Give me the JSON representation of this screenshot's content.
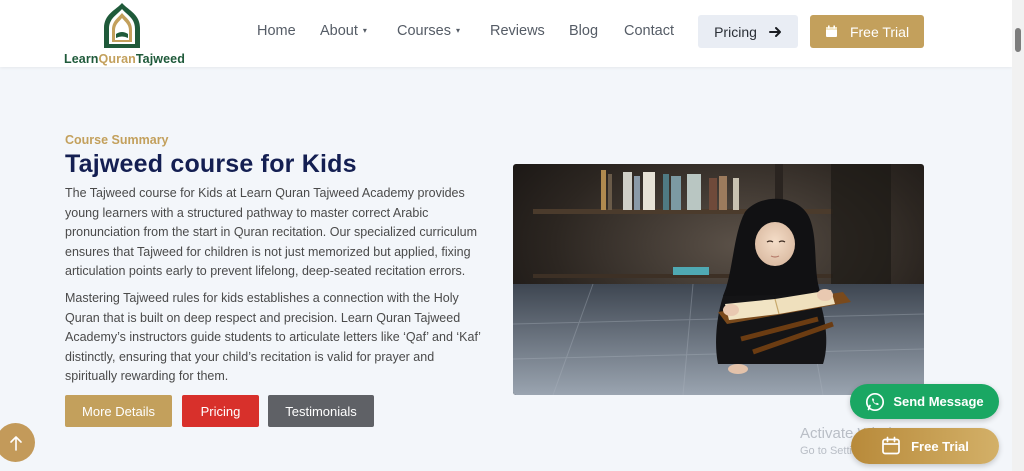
{
  "brand": {
    "name_part1": "Learn",
    "name_part2": "Quran",
    "name_part3": "Tajweed"
  },
  "nav": {
    "home": "Home",
    "about": "About",
    "courses": "Courses",
    "reviews": "Reviews",
    "blog": "Blog",
    "contact": "Contact",
    "caret": "▾"
  },
  "header_buttons": {
    "pricing": "Pricing",
    "free_trial": "Free Trial"
  },
  "course": {
    "eyebrow": "Course Summary",
    "title": "Tajweed course for Kids",
    "paragraph1": "The Tajweed course for Kids at Learn Quran Tajweed Academy provides young learners with a structured pathway to master correct Arabic pronunciation from the start in Quran recitation. Our specialized curriculum ensures that Tajweed for children is not just memorized but applied, fixing articulation points early to prevent lifelong, deep-seated recitation errors.",
    "paragraph2": "Mastering Tajweed rules for kids establishes a connection with the Holy Quran that is built on deep respect and precision. Learn Quran Tajweed Academy’s instructors guide students to articulate letters like ‘Qaf’ and ‘Kaf’ distinctly, ensuring that your child’s recitation is valid for prayer and spiritually rewarding for them.",
    "buttons": {
      "details": "More Details",
      "pricing": "Pricing",
      "testimonials": "Testimonials"
    }
  },
  "floating": {
    "whatsapp": "Send Message",
    "free_trial": "Free Trial"
  },
  "watermark": {
    "line1": "Activate Windows",
    "line2": "Go to Settings to activate Windows."
  },
  "colors": {
    "gold": "#c3a05c",
    "navy": "#141f52",
    "red": "#d8302b",
    "gray": "#5f6166",
    "green": "#1aa763"
  }
}
